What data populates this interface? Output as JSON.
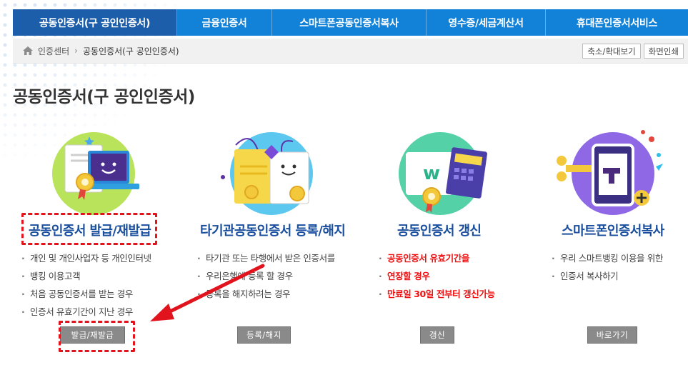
{
  "tabs": [
    {
      "label": "공동인증서(구 공인인증서)",
      "active": true
    },
    {
      "label": "금융인증서",
      "active": false
    },
    {
      "label": "스마트폰공동인증서복사",
      "active": false
    },
    {
      "label": "영수증/세금계산서",
      "active": false
    },
    {
      "label": "휴대폰인증서서비스",
      "active": false
    }
  ],
  "breadcrumb": {
    "home_icon": "home-icon",
    "items": [
      "인증센터",
      "공동인증서(구 공인인증서)"
    ],
    "separator": "›"
  },
  "toolbar": {
    "zoom_label": "축소/확대보기",
    "print_label": "화면인쇄"
  },
  "page_title": "공동인증서(구 공인인증서)",
  "cards": [
    {
      "title": "공동인증서 발급/재발급",
      "desc": [
        "개인 및 개인사업자 등 개인인터넷",
        "뱅킹 이용고객",
        "처음 공동인증서를 받는 경우",
        "인증서 유효기간이 지난 경우"
      ],
      "button": "발급/재발급"
    },
    {
      "title": "타기관공동인증서 등록/해지",
      "desc": [
        "타기관 또는 타행에서 받은 인증서를",
        "우리은행에 등록 할 경우",
        "등록을 해지하려는 경우"
      ],
      "button": "등록/해지"
    },
    {
      "title": "공동인증서 갱신",
      "desc": [
        "공동인증서 유효기간을",
        "연장할 경우",
        "만료일 30일 전부터 갱신가능"
      ],
      "button": "갱신"
    },
    {
      "title": "스마트폰인증서복사",
      "desc": [
        "우리 스마트뱅킹 이용을 위한",
        "인증서 복사하기"
      ],
      "button": "바로가기"
    }
  ],
  "colors": {
    "tab_bg": "#1282d8",
    "tab_active": "#1c5ea9",
    "card_title": "#1a4f9e",
    "highlight": "#e1141e",
    "arrow": "#e1141e",
    "button_bg": "#8a8a8a"
  }
}
